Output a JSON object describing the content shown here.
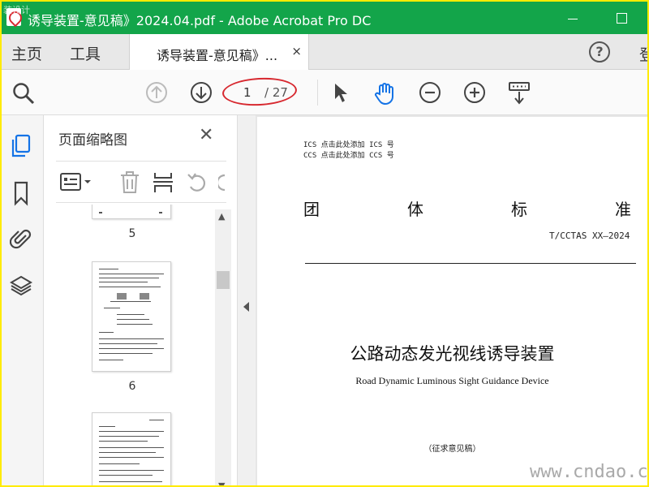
{
  "window": {
    "title": "诱导装置-意见稿》2024.04.pdf - Adobe Acrobat Pro DC",
    "watermark_top": "装设计"
  },
  "tabs": {
    "home": "主页",
    "tools": "工具",
    "document": "诱导装置-意见稿》...",
    "close": "×",
    "signin_cut": "登"
  },
  "toolbar": {
    "current_page": "1",
    "total_pages": "/ 27",
    "icons": [
      "search-zoom-icon",
      "prev-page-icon",
      "next-page-icon",
      "select-cursor-icon",
      "hand-tool-icon",
      "zoom-out-icon",
      "zoom-in-icon",
      "scroll-mode-icon"
    ]
  },
  "panel": {
    "title": "页面缩略图",
    "close": "✕",
    "thumbnails": [
      {
        "label": "5"
      },
      {
        "label": "6"
      }
    ]
  },
  "document": {
    "ics": "ICS  点击此处添加 ICS 号",
    "ccs": "CCS  点击此处添加 CCS 号",
    "std_chars": [
      "团",
      "体",
      "标",
      "准"
    ],
    "std_code": "T/CCTAS XX—2024",
    "title": "公路动态发光视线诱导装置",
    "subtitle": "Road Dynamic Luminous Sight Guidance Device",
    "note": "（征求意见稿）"
  },
  "watermark": "www.cndao.com",
  "colors": {
    "titlebar": "#13a54a",
    "frame": "#ffeb00",
    "accent_blue": "#1473e6",
    "annotation_red": "#d7282f"
  }
}
